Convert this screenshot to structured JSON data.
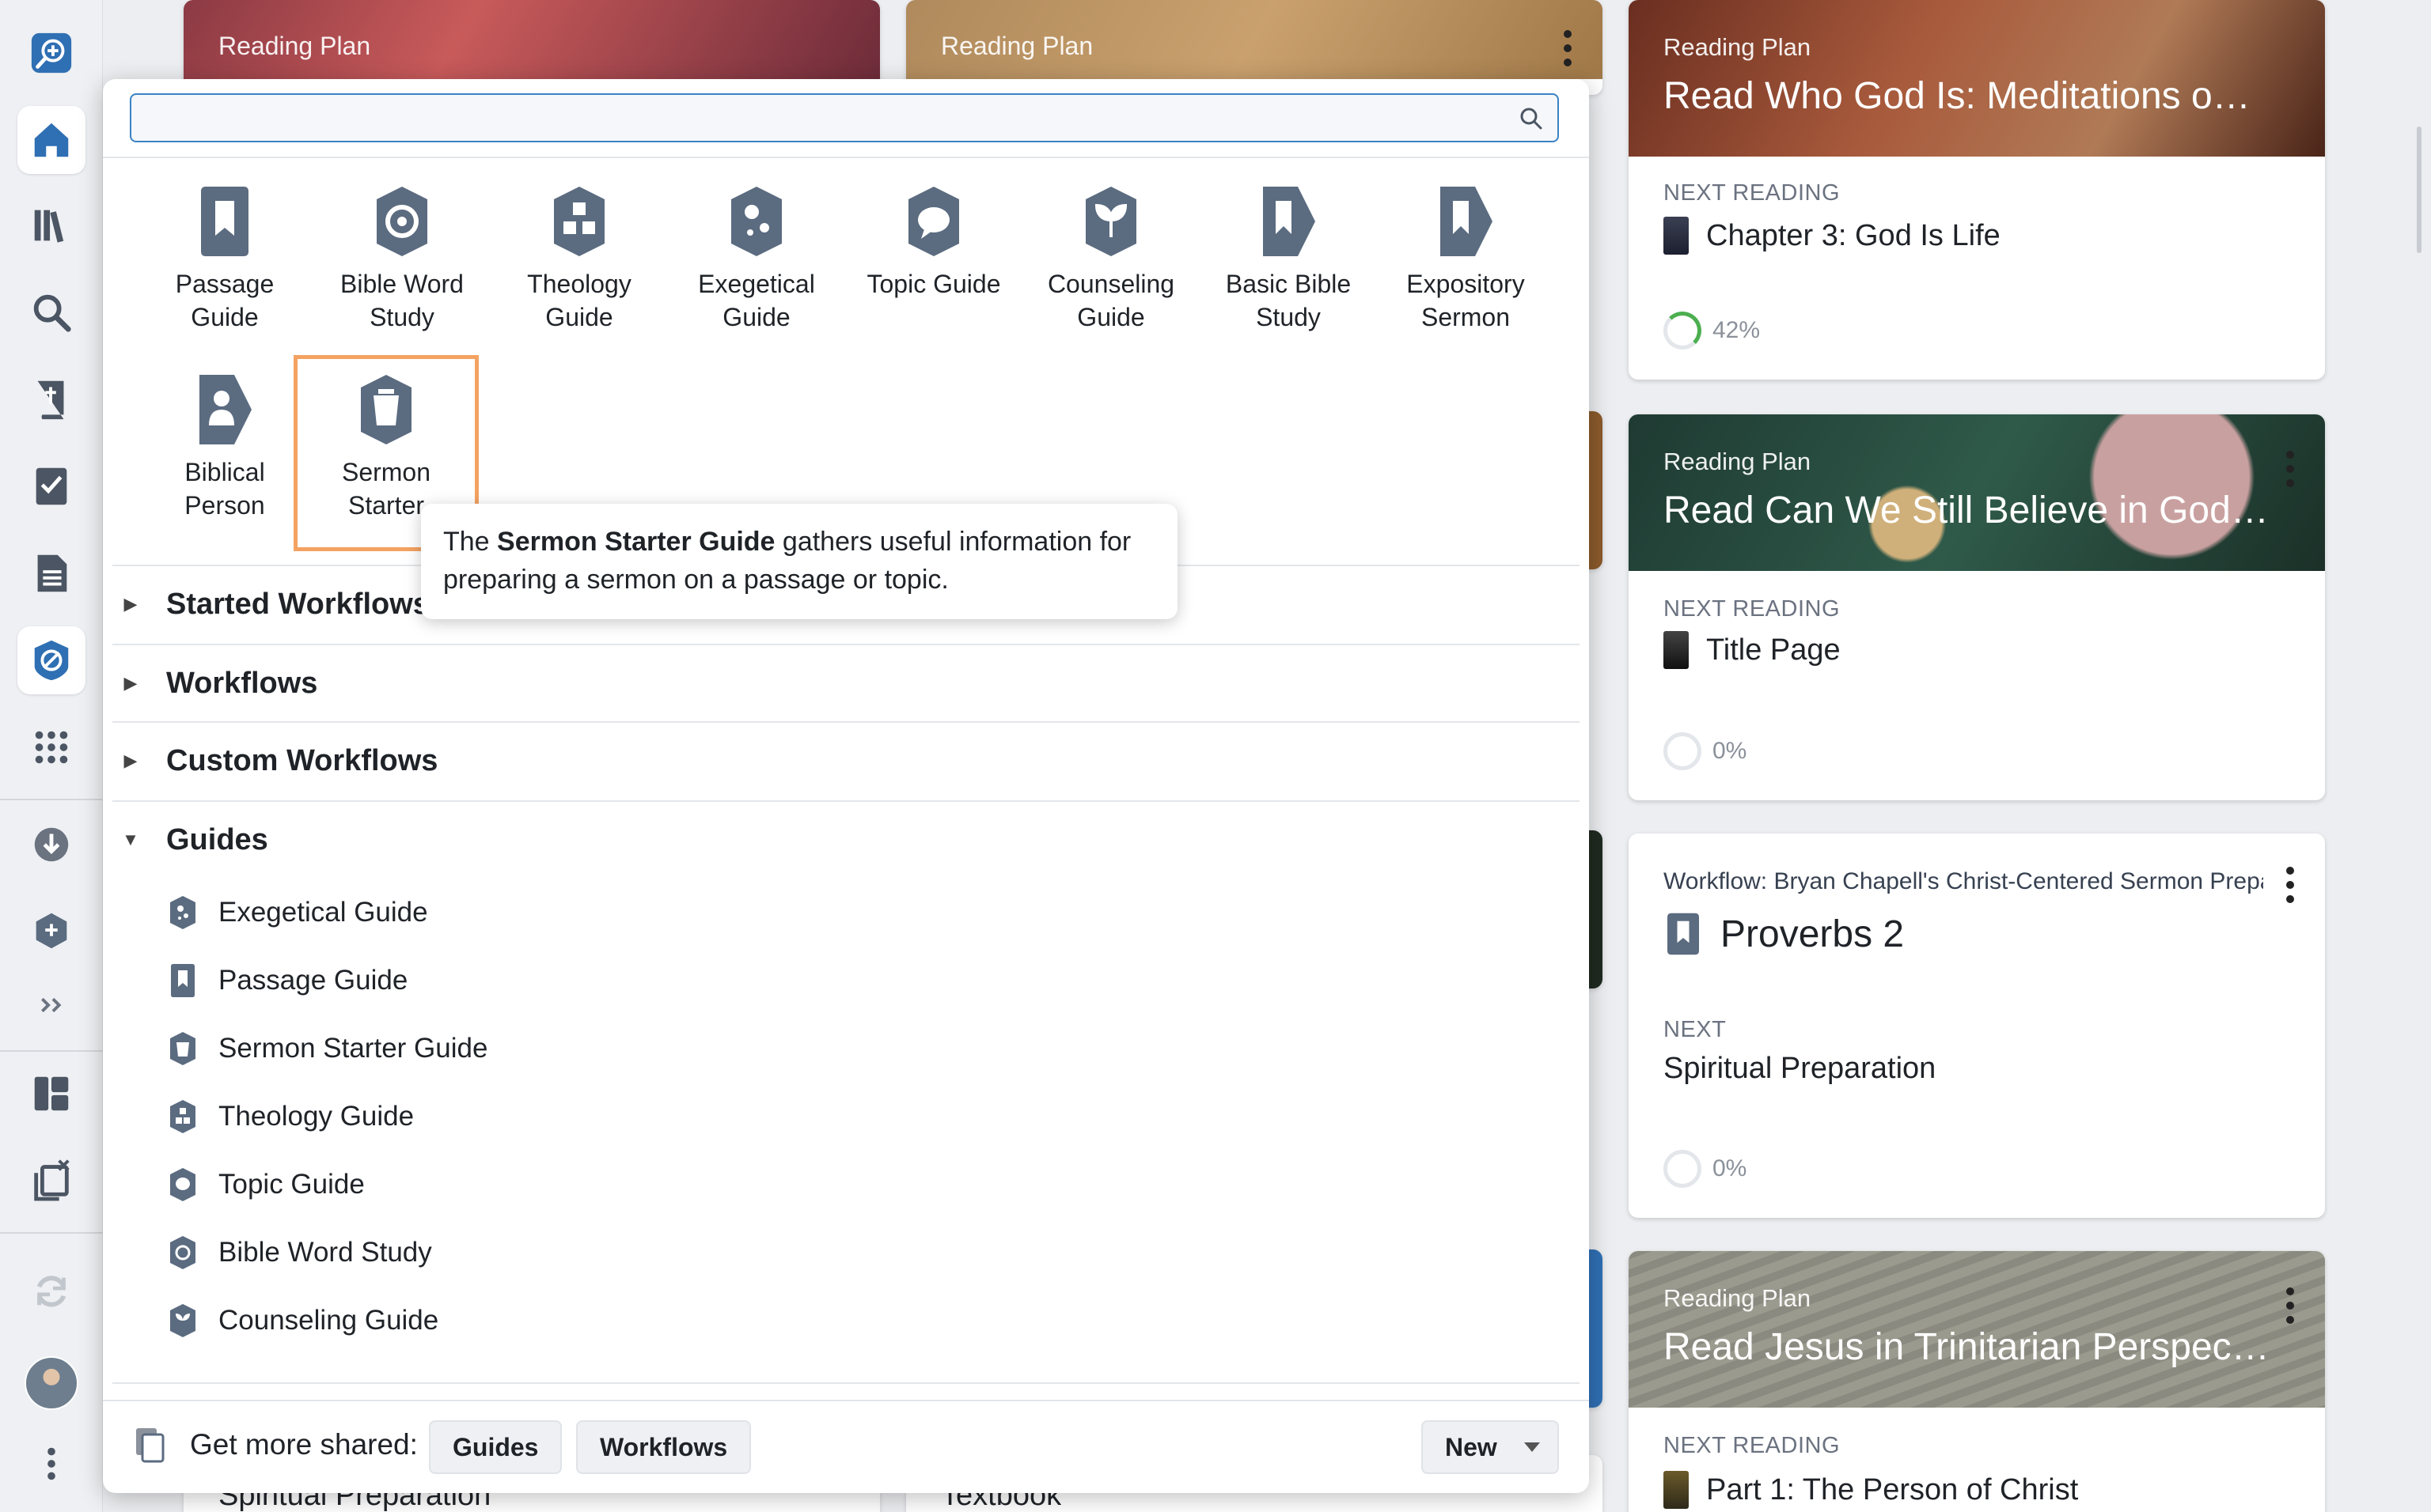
{
  "rail": {
    "items": [
      {
        "name": "app-logo-icon"
      },
      {
        "name": "home-icon",
        "active": true
      },
      {
        "name": "library-icon"
      },
      {
        "name": "search-icon"
      },
      {
        "name": "bible-icon"
      },
      {
        "name": "checklist-icon"
      },
      {
        "name": "document-icon"
      },
      {
        "name": "guides-icon",
        "active": true
      },
      {
        "name": "apps-grid-icon"
      },
      {
        "name": "download-icon"
      },
      {
        "name": "hex-add-icon"
      },
      {
        "name": "expand-icon"
      },
      {
        "name": "layout-icon"
      },
      {
        "name": "close-panels-icon"
      },
      {
        "name": "sync-icon"
      },
      {
        "name": "more-icon"
      }
    ]
  },
  "background": {
    "top_cards": [
      {
        "label": "Reading Plan"
      },
      {
        "label": "Reading Plan"
      }
    ],
    "bottom_texts": [
      "Spiritual Preparation",
      "Textbook"
    ],
    "right_cards": [
      {
        "label": "Reading Plan",
        "title": "Read Who God Is: Meditations on ...",
        "next_label": "NEXT READING",
        "next_item": "Chapter 3: God Is Life",
        "progress": "42%",
        "progress_value": 0.42
      },
      {
        "label": "Reading Plan",
        "title": "Read Can We Still Believe in God?:...",
        "next_label": "NEXT READING",
        "next_item": "Title Page",
        "progress": "0%",
        "progress_value": 0
      },
      {
        "label": "Workflow: Bryan Chapell's Christ-Centered Sermon Prepa",
        "title": "Proverbs 2",
        "next_label": "NEXT",
        "next_item": "Spiritual Preparation",
        "progress": "0%",
        "progress_value": 0
      },
      {
        "label": "Reading Plan",
        "title": "Read Jesus in Trinitarian Perspect...",
        "next_label": "NEXT READING",
        "next_item": "Part 1: The Person of Christ"
      }
    ]
  },
  "panel": {
    "search": {
      "placeholder": ""
    },
    "tiles": [
      {
        "line1": "Passage",
        "line2": "Guide",
        "icon": "passage-guide-icon"
      },
      {
        "line1": "Bible Word",
        "line2": "Study",
        "icon": "bible-word-study-icon"
      },
      {
        "line1": "Theology",
        "line2": "Guide",
        "icon": "theology-guide-icon"
      },
      {
        "line1": "Exegetical",
        "line2": "Guide",
        "icon": "exegetical-guide-icon"
      },
      {
        "line1": "Topic Guide",
        "line2": "",
        "icon": "topic-guide-icon"
      },
      {
        "line1": "Counseling",
        "line2": "Guide",
        "icon": "counseling-guide-icon"
      },
      {
        "line1": "Basic Bible",
        "line2": "Study",
        "icon": "basic-bible-study-icon"
      },
      {
        "line1": "Expository",
        "line2": "Sermon",
        "icon": "expository-sermon-icon"
      },
      {
        "line1": "Biblical",
        "line2": "Person",
        "icon": "biblical-person-icon"
      },
      {
        "line1": "Sermon",
        "line2": "Starter",
        "icon": "sermon-starter-icon",
        "selected": true
      }
    ],
    "tooltip": {
      "pre": "The ",
      "bold": "Sermon Starter Guide",
      "post": " gathers useful information for preparing a sermon on a passage or topic."
    },
    "sections": [
      {
        "title": "Started Workflows",
        "expanded": false
      },
      {
        "title": "Workflows",
        "expanded": false
      },
      {
        "title": "Custom Workflows",
        "expanded": false
      },
      {
        "title": "Guides",
        "expanded": true
      }
    ],
    "guides": [
      {
        "label": "Exegetical Guide",
        "icon": "exegetical-guide-icon"
      },
      {
        "label": "Passage Guide",
        "icon": "passage-guide-icon"
      },
      {
        "label": "Sermon Starter Guide",
        "icon": "sermon-starter-icon"
      },
      {
        "label": "Theology Guide",
        "icon": "theology-guide-icon"
      },
      {
        "label": "Topic Guide",
        "icon": "topic-guide-icon"
      },
      {
        "label": "Bible Word Study",
        "icon": "bible-word-study-icon"
      },
      {
        "label": "Counseling Guide",
        "icon": "counseling-guide-icon"
      }
    ],
    "footer": {
      "label": "Get more shared:",
      "guides_button": "Guides",
      "workflows_button": "Workflows",
      "sort_button": "New"
    }
  },
  "colors": {
    "accent": "#3b82c4",
    "icon_slate": "#5b6b80",
    "selection": "#f4a261",
    "progress": "#4caf50"
  }
}
